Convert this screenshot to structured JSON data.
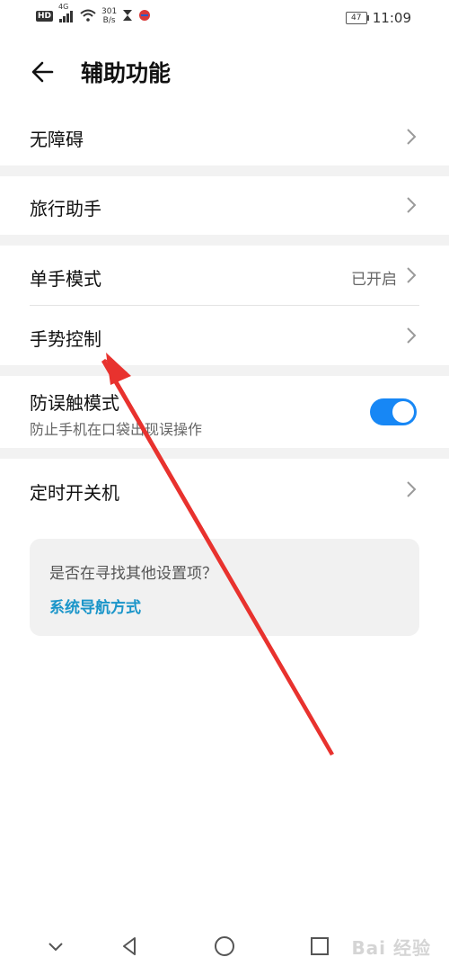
{
  "status_bar": {
    "hd": "HD",
    "signal": "4G",
    "net_speed_value": "301",
    "net_speed_unit": "B/s",
    "battery": "47",
    "time": "11:09"
  },
  "header": {
    "title": "辅助功能"
  },
  "items": {
    "accessibility": "无障碍",
    "travel_assistant": "旅行助手",
    "one_hand": {
      "label": "单手模式",
      "value": "已开启"
    },
    "gesture": "手势控制",
    "mistouch": {
      "label": "防误触模式",
      "sub": "防止手机在口袋出现误操作",
      "enabled": true
    },
    "scheduled_power": "定时开关机"
  },
  "suggestion": {
    "question": "是否在寻找其他设置项？",
    "link": "系统导航方式"
  },
  "watermark": "Bai 经验",
  "colors": {
    "accent": "#1787f5",
    "link": "#1a95c9",
    "annotation_arrow": "#e8322e"
  }
}
